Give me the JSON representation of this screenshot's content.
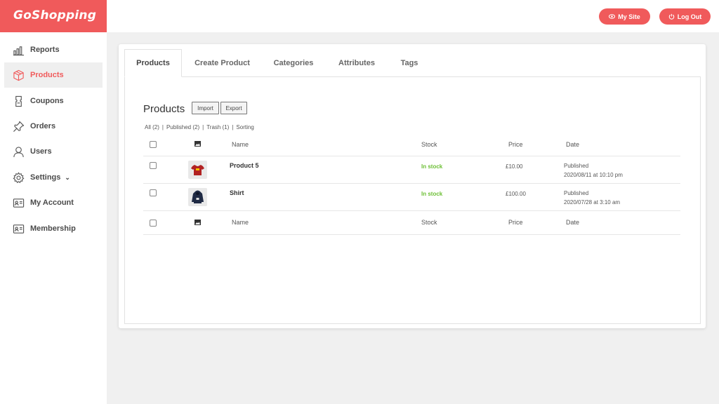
{
  "brand": {
    "name": "GoShopping",
    "accent": "#f05a5b"
  },
  "header": {
    "my_site_label": "My Site",
    "log_out_label": "Log Out"
  },
  "sidebar": {
    "items": [
      {
        "label": "Reports",
        "icon": "bar-chart-icon"
      },
      {
        "label": "Products",
        "icon": "box-icon",
        "active": true
      },
      {
        "label": "Coupons",
        "icon": "coupon-icon"
      },
      {
        "label": "Orders",
        "icon": "pin-icon"
      },
      {
        "label": "Users",
        "icon": "user-icon"
      },
      {
        "label": "Settings",
        "icon": "gear-icon",
        "has_dropdown": true
      },
      {
        "label": "My Account",
        "icon": "id-card-icon"
      },
      {
        "label": "Membership",
        "icon": "id-card-icon"
      }
    ]
  },
  "tabs": [
    "Products",
    "Create Product",
    "Categories",
    "Attributes",
    "Tags"
  ],
  "products_panel": {
    "title": "Products",
    "import_label": "Import",
    "export_label": "Export",
    "filters": [
      "All (2)",
      "Published (2)",
      "Trash (1)",
      "Sorting"
    ],
    "columns": {
      "name": "Name",
      "stock": "Stock",
      "price": "Price",
      "date": "Date"
    },
    "rows": [
      {
        "name": "Product 5",
        "stock": "In stock",
        "price": "£10.00",
        "status": "Published",
        "date": "2020/08/11 at 10:10 pm",
        "thumb": "red-tshirt"
      },
      {
        "name": "Shirt",
        "stock": "In stock",
        "price": "£100.00",
        "status": "Published",
        "date": "2020/07/28 at 3:10 am",
        "thumb": "navy-hoodie"
      }
    ]
  }
}
